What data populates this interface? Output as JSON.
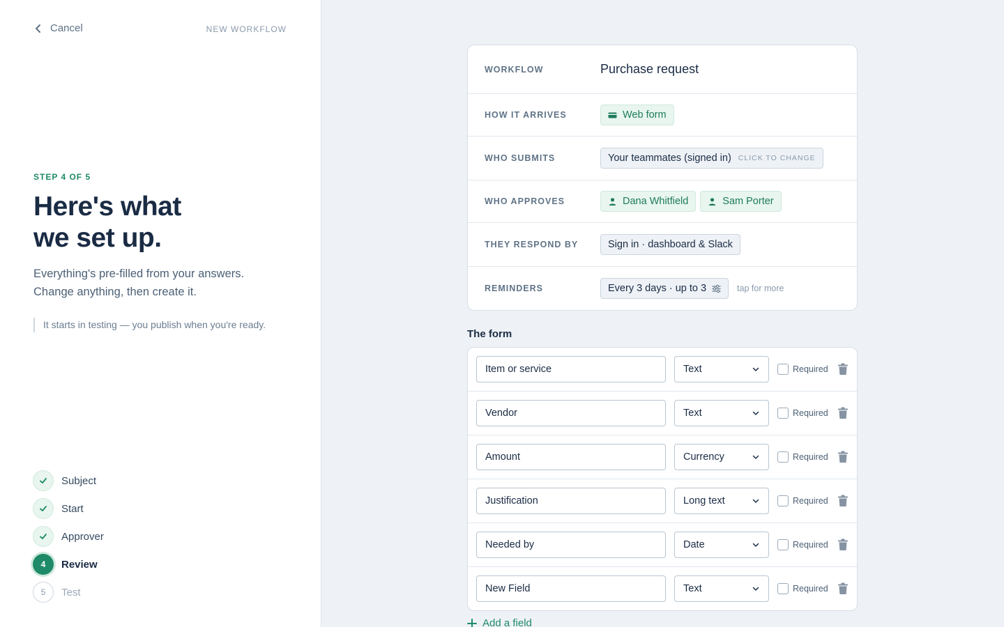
{
  "left": {
    "cancel_label": "Cancel",
    "context_label": "NEW WORKFLOW",
    "step_label": "STEP 4 OF 5",
    "headline_line1": "Here's what",
    "headline_line2": "we set up.",
    "sub_line1": "Everything's pre-filled from your answers.",
    "sub_line2": "Change anything, then create it.",
    "note": "It starts in testing — you publish when you're ready.",
    "steps": [
      {
        "number": "1",
        "label": "Subject",
        "state": "done"
      },
      {
        "number": "2",
        "label": "Start",
        "state": "done"
      },
      {
        "number": "3",
        "label": "Approver",
        "state": "done"
      },
      {
        "number": "4",
        "label": "Review",
        "state": "active"
      },
      {
        "number": "5",
        "label": "Test",
        "state": "todo"
      }
    ]
  },
  "summary": {
    "workflow_label": "WORKFLOW",
    "workflow_value": "Purchase request",
    "arrives_label": "HOW IT ARRIVES",
    "arrives_value": "Web form",
    "submits_label": "WHO SUBMITS",
    "submits_value": "Your teammates (signed in)",
    "submits_hint": "CLICK TO CHANGE",
    "approves_label": "WHO APPROVES",
    "approvers": [
      "Dana Whitfield",
      "Sam Porter"
    ],
    "respond_label": "THEY RESPOND BY",
    "respond_value": "Sign in · dashboard & Slack",
    "reminders_label": "REMINDERS",
    "reminders_value": "Every 3 days · up to 3",
    "reminders_hint": "tap for more"
  },
  "form": {
    "title": "The form",
    "required_label": "Required",
    "fields": [
      {
        "name": "Item or service",
        "type": "Text"
      },
      {
        "name": "Vendor",
        "type": "Text"
      },
      {
        "name": "Amount",
        "type": "Currency"
      },
      {
        "name": "Justification",
        "type": "Long text"
      },
      {
        "name": "Needed by",
        "type": "Date"
      },
      {
        "name": "New Field",
        "type": "Text"
      }
    ],
    "add_field_label": "Add a field"
  },
  "colors": {
    "accent": "#1e8a68",
    "background": "#eef2f6"
  }
}
